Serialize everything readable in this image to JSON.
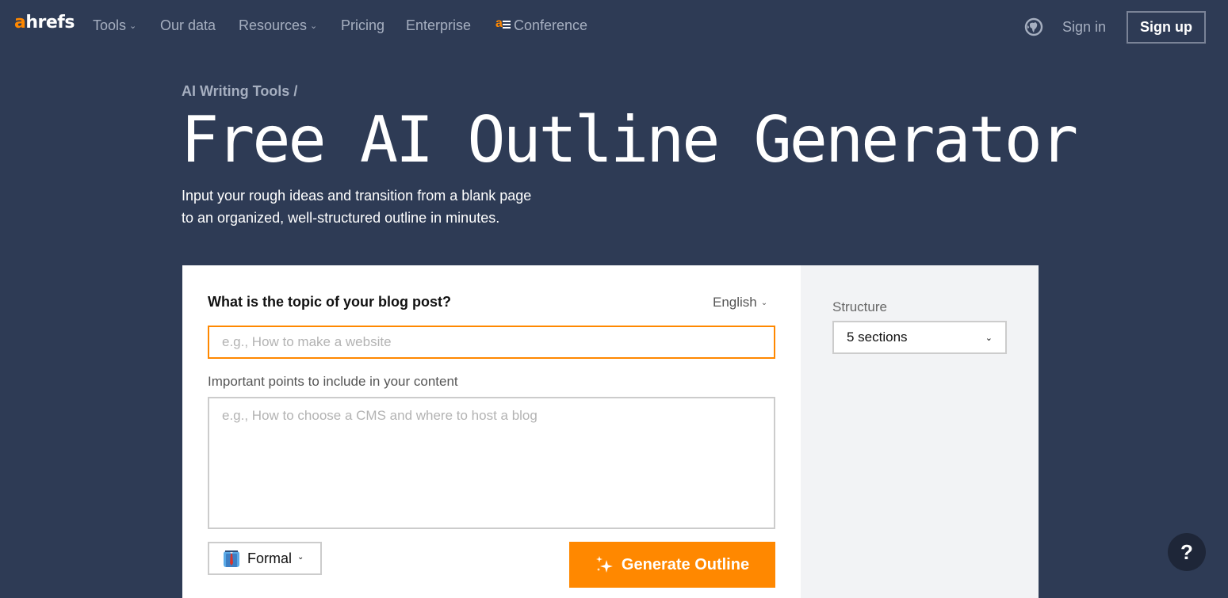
{
  "nav": {
    "logo": {
      "prefix": "a",
      "rest": "hrefs"
    },
    "items": [
      {
        "label": "Tools",
        "has_dropdown": true,
        "chevron": "⌄"
      },
      {
        "label": "Our data",
        "has_dropdown": false
      },
      {
        "label": "Resources",
        "has_dropdown": true,
        "chevron": "⌄"
      },
      {
        "label": "Pricing",
        "has_dropdown": false
      },
      {
        "label": "Enterprise",
        "has_dropdown": false
      },
      {
        "label": "Conference",
        "has_dropdown": false,
        "icon": "ahrefs-evolve-logo"
      }
    ],
    "globe_icon": "globe-icon",
    "sign_in": "Sign in",
    "sign_up": "Sign up"
  },
  "hero": {
    "breadcrumb": "AI Writing Tools /",
    "title": "Free AI Outline Generator",
    "subtitle_line1": "Input your rough ideas and transition from a blank page",
    "subtitle_line2": "to an organized, well-structured outline in minutes."
  },
  "form": {
    "topic_label": "What is the topic of your blog post?",
    "language": {
      "selected": "English",
      "chevron": "⌄"
    },
    "topic_input": {
      "value": "",
      "placeholder": "e.g., How to make a website"
    },
    "points_label": "Important points to include in your content",
    "points_input": {
      "value": "",
      "placeholder": "e.g., How to choose a CMS and where to host a blog"
    },
    "tone": {
      "selected": "Formal",
      "icon": "necktie-shirt-emoji",
      "chevron": "⌄"
    },
    "generate_button": {
      "label": "Generate Outline",
      "icon": "sparkles-icon"
    }
  },
  "sidebar": {
    "structure_label": "Structure",
    "structure": {
      "selected": "5 sections",
      "chevron": "⌄"
    }
  },
  "help": {
    "label": "?"
  },
  "colors": {
    "background": "#2e3b55",
    "accent": "#ff8800",
    "nav_text": "#a6afc0",
    "card_side": "#f2f3f5",
    "help_bg": "#1e2638"
  }
}
